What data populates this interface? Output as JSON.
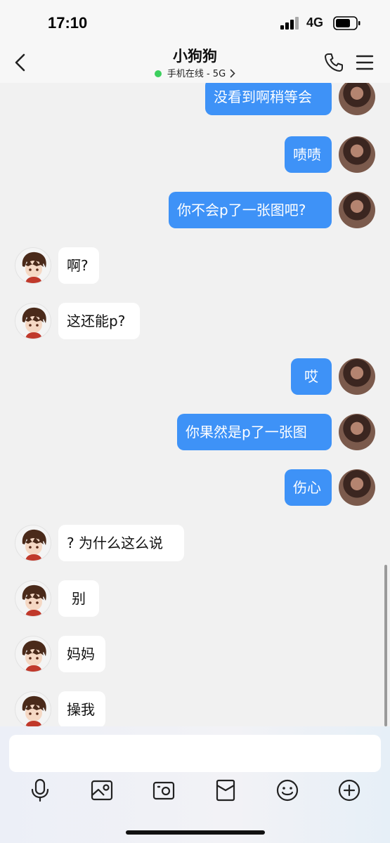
{
  "status": {
    "time": "17:10",
    "network": "4G"
  },
  "header": {
    "title": "小狗狗",
    "subtitle": "手机在线 - 5G"
  },
  "messages": [
    {
      "dir": "out",
      "text": "没看到啊稍等会"
    },
    {
      "dir": "out",
      "text": "啧啧"
    },
    {
      "dir": "out",
      "text": "你不会p了一张图吧?"
    },
    {
      "dir": "in",
      "text": "啊?"
    },
    {
      "dir": "in",
      "text": "这还能p?"
    },
    {
      "dir": "out",
      "text": "哎"
    },
    {
      "dir": "out",
      "text": "你果然是p了一张图"
    },
    {
      "dir": "out",
      "text": "伤心"
    },
    {
      "dir": "in",
      "text": "? 为什么这么说"
    },
    {
      "dir": "in",
      "text": "别"
    },
    {
      "dir": "in",
      "text": "妈妈"
    },
    {
      "dir": "in",
      "text": "操我"
    }
  ],
  "input": {
    "value": ""
  },
  "toolbar": {
    "icons": [
      "microphone-icon",
      "image-icon",
      "camera-icon",
      "red-packet-icon",
      "emoji-icon",
      "plus-icon"
    ]
  },
  "colors": {
    "outgoing_bubble": "#3e92f7",
    "incoming_bubble": "#ffffff",
    "background": "#f1f1f1",
    "online_dot": "#3ccf5e"
  }
}
